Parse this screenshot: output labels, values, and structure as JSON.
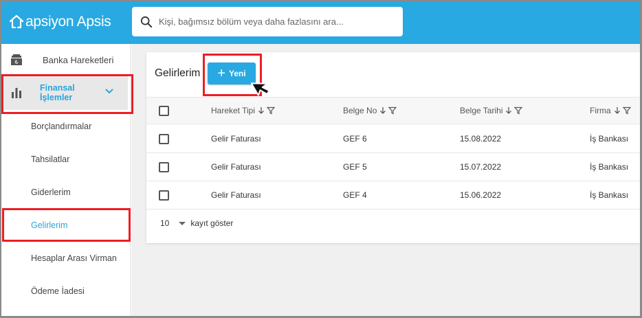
{
  "app": {
    "logo_text": "apsiyon Apsis",
    "logo_icon": "house-outline-icon"
  },
  "search": {
    "placeholder": "Kişi, bağımsız bölüm veya daha fazlasını ara...",
    "value": ""
  },
  "sidebar": {
    "top_item": {
      "label": "Banka Hareketleri",
      "icon": "bank-icon"
    },
    "section": {
      "label": "Finansal İşlemler",
      "icon": "bar-chart-icon",
      "expanded": true
    },
    "sub_items": [
      {
        "label": "Borçlandırmalar",
        "active": false
      },
      {
        "label": "Tahsilatlar",
        "active": false
      },
      {
        "label": "Giderlerim",
        "active": false
      },
      {
        "label": "Gelirlerim",
        "active": true
      },
      {
        "label": "Hesaplar Arası Virman",
        "active": false
      },
      {
        "label": "Ödeme İadesi",
        "active": false
      }
    ]
  },
  "main": {
    "title": "Gelirlerim",
    "new_button": "Yeni",
    "columns": [
      "Hareket Tipi",
      "Belge No",
      "Belge Tarihi",
      "Firma"
    ],
    "rows": [
      [
        "Gelir Faturası",
        "GEF 6",
        "15.08.2022",
        "İş Bankası"
      ],
      [
        "Gelir Faturası",
        "GEF 5",
        "15.07.2022",
        "İş Bankası"
      ],
      [
        "Gelir Faturası",
        "GEF 4",
        "15.06.2022",
        "İş Bankası"
      ]
    ],
    "page_size": "10",
    "page_size_label": "kayıt göster"
  },
  "colors": {
    "accent": "#29a9e1",
    "highlight": "#ee1c24",
    "sidebar_active_bg": "#e8e8e8"
  }
}
